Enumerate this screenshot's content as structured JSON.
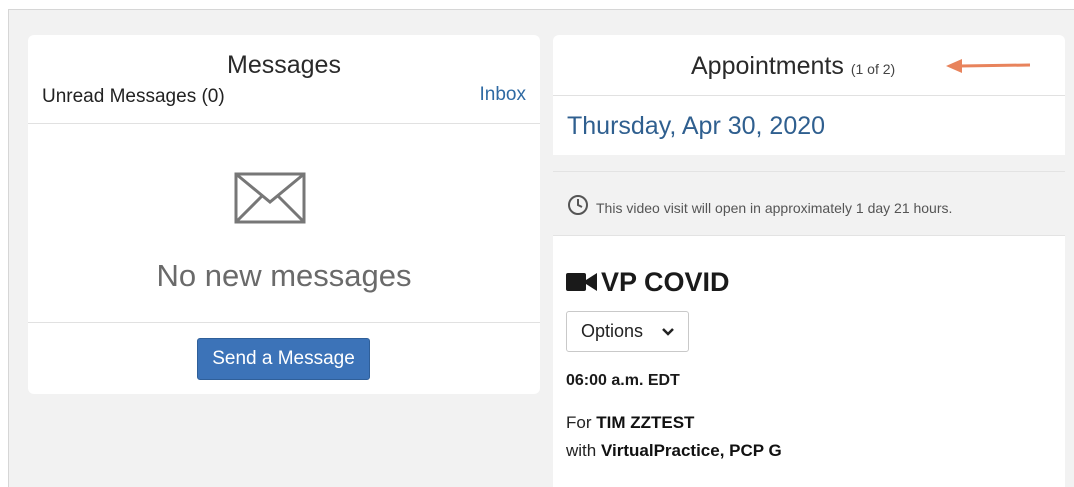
{
  "messages": {
    "title": "Messages",
    "unread_label": "Unread Messages (0)",
    "inbox_link": "Inbox",
    "empty_text": "No new messages",
    "send_button": "Send a Message"
  },
  "appointments": {
    "title": "Appointments",
    "count": "(1 of 2)",
    "date": "Thursday, Apr 30, 2020",
    "notice": "This video visit will open in approximately 1 day 21 hours.",
    "visit_name": "VP COVID",
    "options_label": "Options",
    "time": "06:00 a.m. EDT",
    "for_prefix": "For",
    "patient": "TIM ZZTEST",
    "with_prefix": "with",
    "provider": "VirtualPractice, PCP G"
  },
  "icons": {
    "envelope": "envelope-icon",
    "clock": "clock-icon",
    "video": "video-camera-icon",
    "chevron": "chevron-down-icon",
    "arrow": "arrow-left-icon"
  },
  "colors": {
    "link": "#2f6aa3",
    "button": "#3c73b8",
    "date": "#2f5f8f",
    "arrow": "#e8835c",
    "background": "#f2f2f2"
  }
}
